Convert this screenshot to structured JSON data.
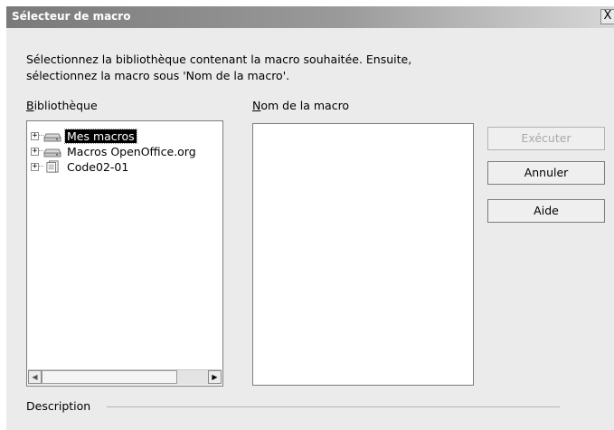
{
  "window": {
    "title": "Sélecteur de macro",
    "close_glyph": "X"
  },
  "intro": {
    "line1": "Sélectionnez la bibliothèque contenant la macro souhaitée. Ensuite,",
    "line2": "sélectionnez la macro sous 'Nom de la macro'."
  },
  "library": {
    "label_mnemonic": "B",
    "label_rest": "ibliothèque",
    "items": [
      {
        "label": "Mes macros",
        "icon": "drive-icon",
        "selected": true
      },
      {
        "label": "Macros OpenOffice.org",
        "icon": "drive-icon",
        "selected": false
      },
      {
        "label": "Code02-01",
        "icon": "document-icon",
        "selected": false
      }
    ]
  },
  "macro_name": {
    "label_mnemonic": "N",
    "label_rest": "om de la macro"
  },
  "buttons": {
    "run": "Exécuter",
    "cancel": "Annuler",
    "help": "Aide"
  },
  "description": {
    "label": "Description"
  }
}
